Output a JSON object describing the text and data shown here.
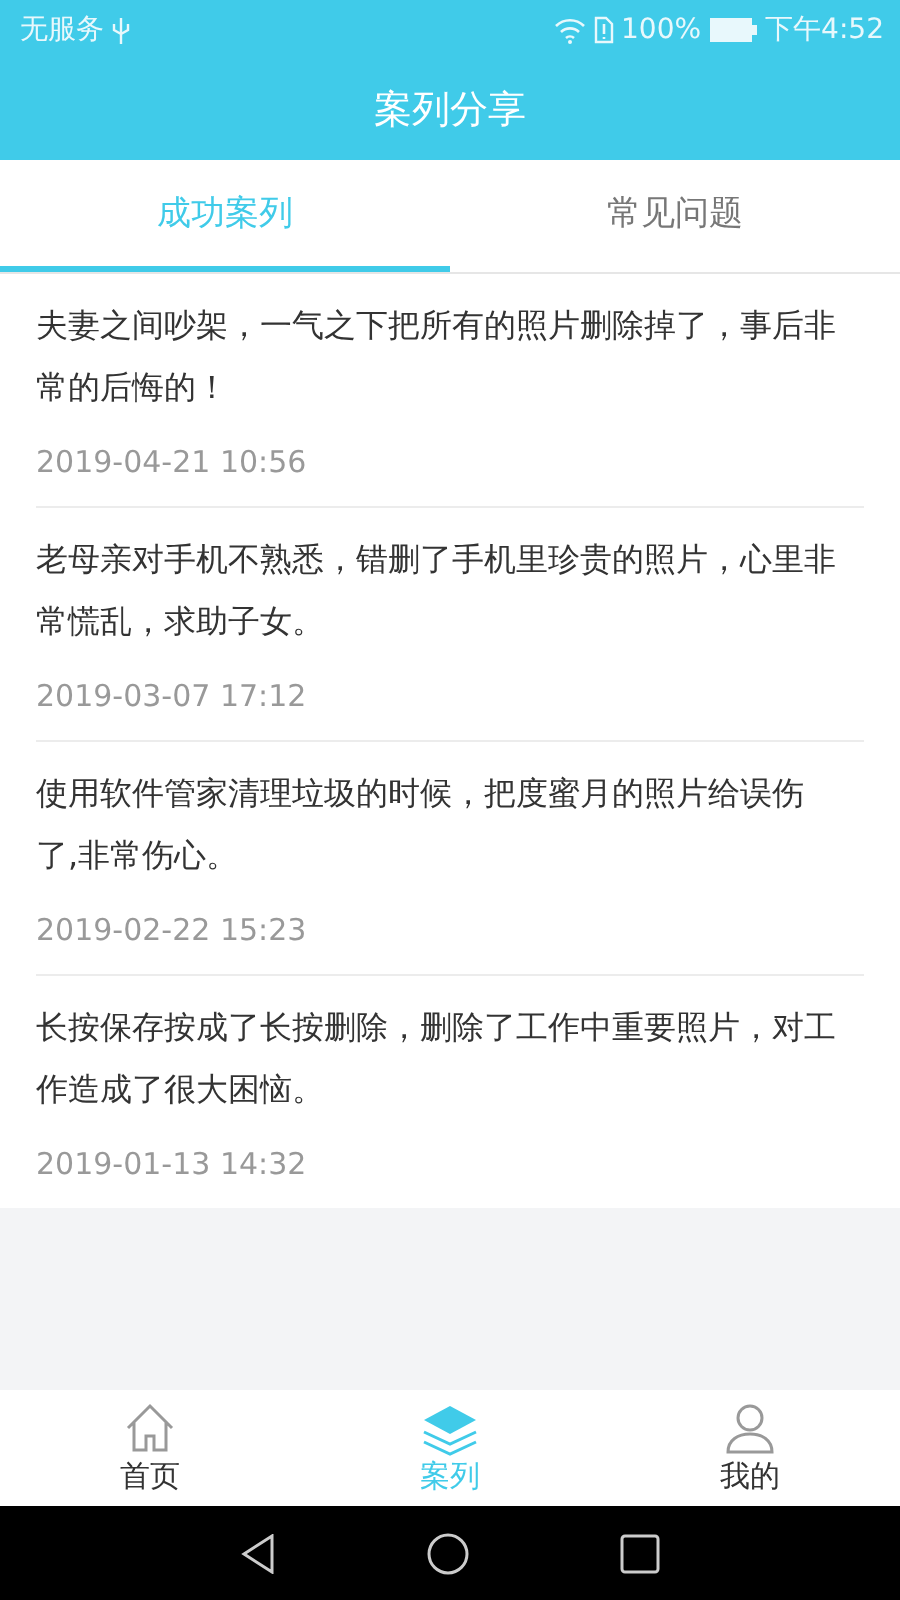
{
  "status_bar": {
    "carrier": "无服务",
    "battery_percent": "100%",
    "time": "下午4:52"
  },
  "header": {
    "title": "案列分享"
  },
  "tabs": [
    {
      "label": "成功案列",
      "selected": true
    },
    {
      "label": "常见问题",
      "selected": false
    }
  ],
  "cases": [
    {
      "text": "夫妻之间吵架，一气之下把所有的照片删除掉了，事后非常的后悔的！",
      "date": "2019-04-21 10:56"
    },
    {
      "text": "老母亲对手机不熟悉，错删了手机里珍贵的照片，心里非常慌乱，求助子女。",
      "date": "2019-03-07 17:12"
    },
    {
      "text": "使用软件管家清理垃圾的时候，把度蜜月的照片给误伤了,非常伤心。",
      "date": "2019-02-22 15:23"
    },
    {
      "text": "长按保存按成了长按删除，删除了工作中重要照片，对工作造成了很大困恼。",
      "date": "2019-01-13 14:32"
    }
  ],
  "bottom_nav": [
    {
      "label": "首页",
      "kind": "home",
      "selected": false
    },
    {
      "label": "案列",
      "kind": "cases",
      "selected": true
    },
    {
      "label": "我的",
      "kind": "profile",
      "selected": false
    }
  ]
}
